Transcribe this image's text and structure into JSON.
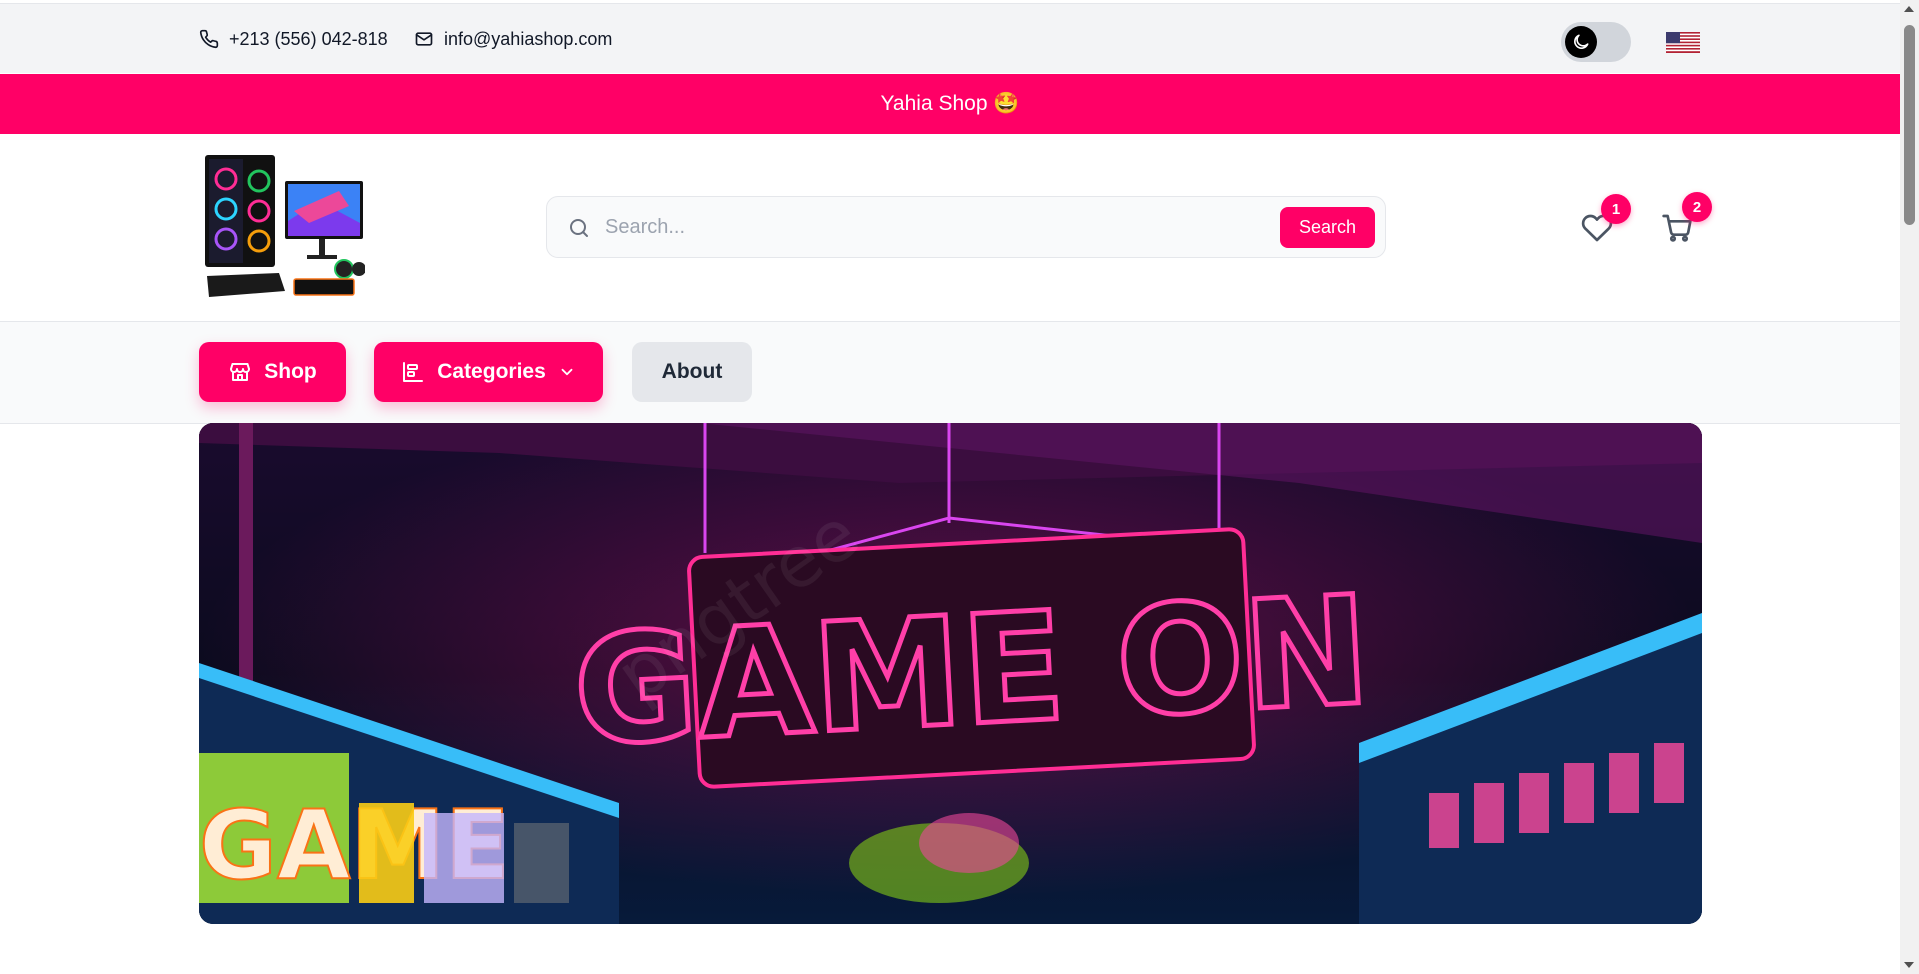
{
  "topbar": {
    "phone": "+213 (556) 042-818",
    "email": "info@yahiashop.com",
    "theme_toggle_icon": "moon-icon",
    "language_flag": "us-flag-icon"
  },
  "announcement": {
    "text": "Yahia Shop 🤩"
  },
  "header": {
    "logo_icon": "gaming-pc-logo",
    "search": {
      "placeholder": "Search...",
      "value": "",
      "button_label": "Search"
    },
    "wishlist_count": "1",
    "cart_count": "2"
  },
  "nav": {
    "shop_label": "Shop",
    "categories_label": "Categories",
    "about_label": "About"
  },
  "hero": {
    "sign_text": "GAME ON",
    "side_text": "GAME",
    "watermark": "pngtree"
  },
  "colors": {
    "accent": "#ff0066",
    "topbar_bg": "#f3f4f6",
    "nav_bg": "#f9fafb"
  }
}
